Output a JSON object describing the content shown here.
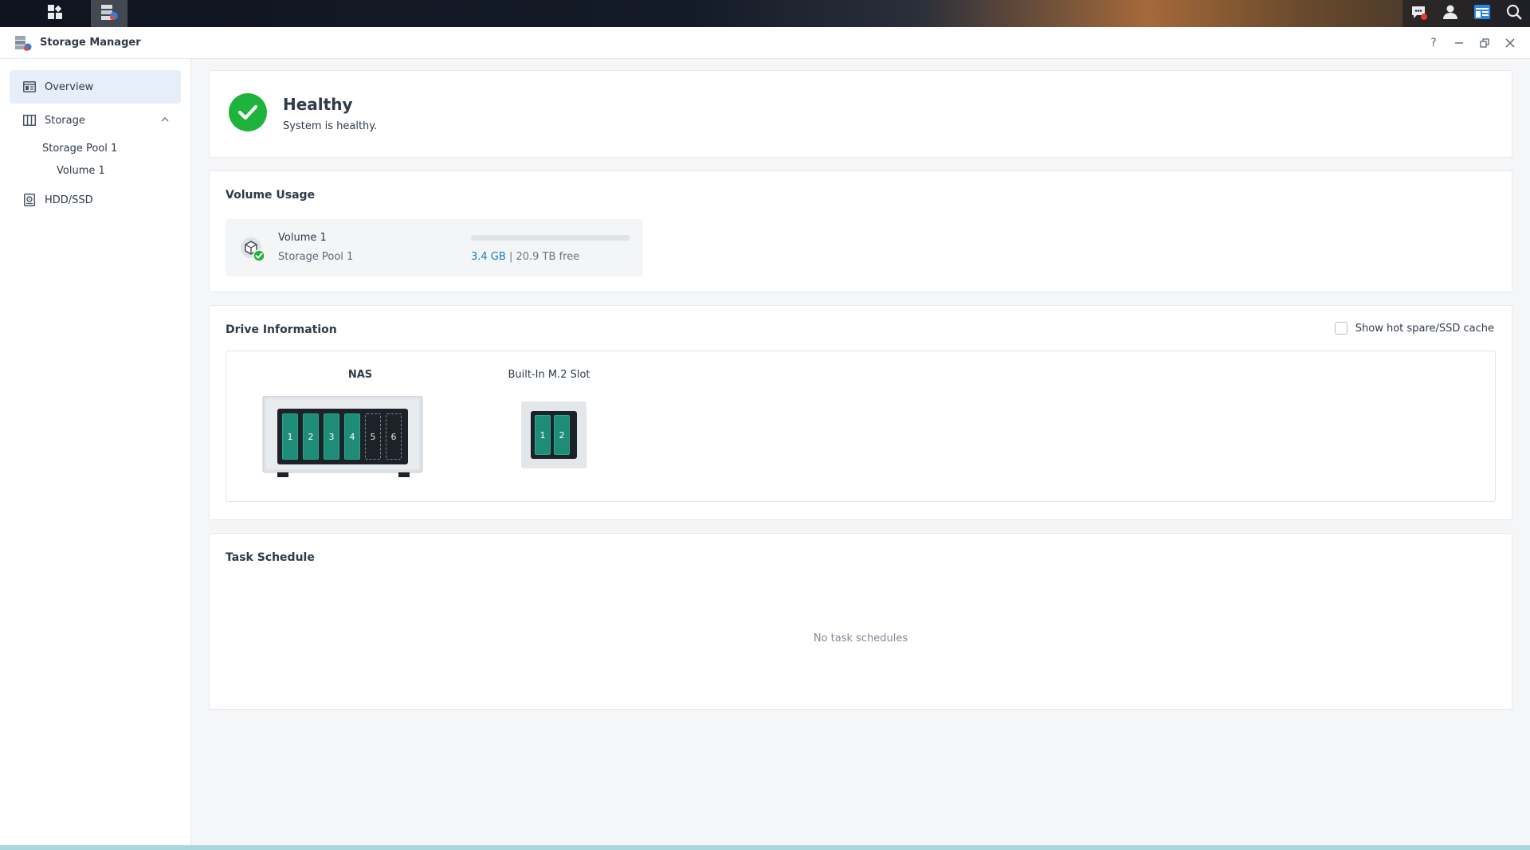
{
  "window": {
    "title": "Storage Manager",
    "controls": {
      "help": "?",
      "minimize": "–",
      "restore": "▭",
      "close": "✕"
    }
  },
  "taskbar": {
    "left_icons": [
      "grid-icon",
      "storage-manager-icon"
    ],
    "right_icons": [
      "chat-notification-icon",
      "user-icon",
      "widgets-icon",
      "search-icon"
    ]
  },
  "sidebar": {
    "items": [
      {
        "label": "Overview",
        "icon": "overview-icon",
        "selected": true
      },
      {
        "label": "Storage",
        "icon": "storage-icon",
        "expanded": true,
        "children": [
          {
            "label": "Storage Pool 1",
            "children": [
              {
                "label": "Volume 1"
              }
            ]
          }
        ]
      },
      {
        "label": "HDD/SSD",
        "icon": "hdd-icon"
      }
    ]
  },
  "health": {
    "title": "Healthy",
    "subtitle": "System is healthy.",
    "status_color": "#1eb43c"
  },
  "volume_usage": {
    "title": "Volume Usage",
    "volumes": [
      {
        "name": "Volume 1",
        "pool": "Storage Pool 1",
        "used": "3.4 GB",
        "separator": "|",
        "free": "20.9 TB free",
        "used_fraction": 0.0002
      }
    ]
  },
  "drive_info": {
    "title": "Drive Information",
    "hot_spare_label": "Show hot spare/SSD cache",
    "hot_spare_checked": false,
    "nas": {
      "label": "NAS",
      "bays": [
        "1",
        "2",
        "3",
        "4",
        "5",
        "6"
      ],
      "occupied": [
        true,
        true,
        true,
        true,
        false,
        false
      ]
    },
    "m2": {
      "label": "Built-In M.2 Slot",
      "slots": [
        "1",
        "2"
      ]
    }
  },
  "task_schedule": {
    "title": "Task Schedule",
    "empty_text": "No task schedules"
  },
  "colors": {
    "accent": "#1a7dc4",
    "drive": "#1f8c78",
    "healthy": "#1eb43c"
  }
}
